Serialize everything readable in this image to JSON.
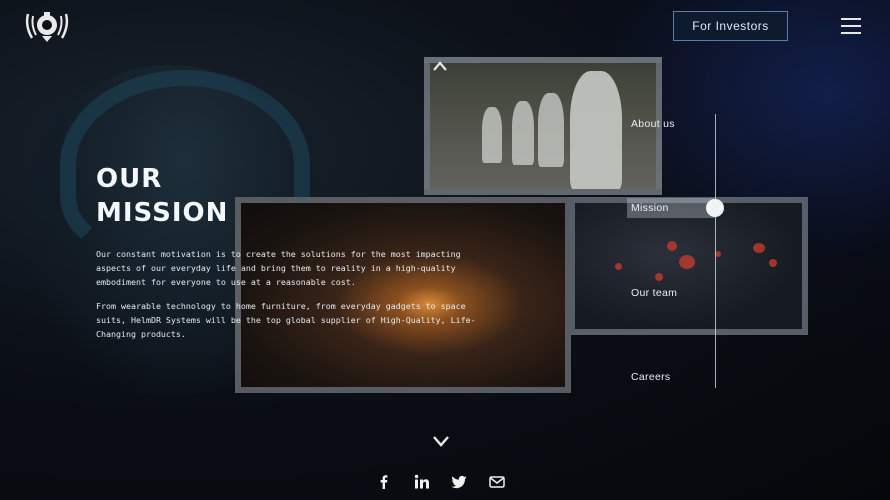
{
  "header": {
    "logo_icon": "helmet-logo-icon",
    "investors_label": "For Investors",
    "menu_icon": "hamburger-menu-icon"
  },
  "mission": {
    "title": "OUR\nMISSION",
    "paragraph1": "Our constant motivation is to create the solutions for the most impacting aspects of our everyday life and bring them to reality in a high-quality embodiment for everyone to use at a reasonable cost.",
    "paragraph2": "From wearable technology to home furniture, from everyday gadgets to space suits, HelmDR Systems will be the top global supplier of High-Quality, Life-Changing products."
  },
  "side_nav": {
    "items": [
      {
        "label": "About us",
        "active": false
      },
      {
        "label": "Mission",
        "active": true
      },
      {
        "label": "Our team",
        "active": false
      },
      {
        "label": "Careers",
        "active": false
      }
    ]
  },
  "scroll": {
    "up_icon": "chevron-up-icon",
    "down_icon": "chevron-down-icon"
  },
  "social": [
    "facebook-icon",
    "linkedin-icon",
    "twitter-icon",
    "email-icon"
  ],
  "colors": {
    "accent_border": "#5a7aa8",
    "background": "#0b0f16",
    "text": "#e8eef5"
  }
}
